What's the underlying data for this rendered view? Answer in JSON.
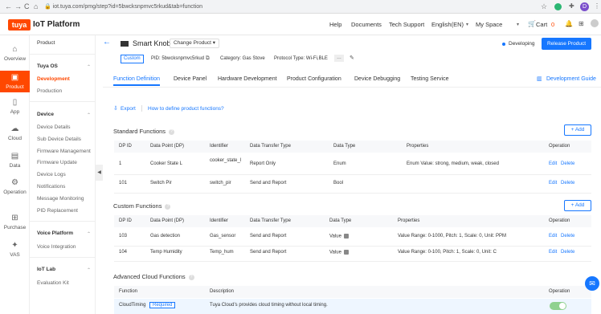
{
  "browser": {
    "url": "iot.tuya.com/pmg/step?id=5bwcksnpmvc5rkud&tab=function",
    "avatar": "D",
    "back": "←",
    "forward": "→",
    "reload": "C",
    "home": "⌂"
  },
  "header": {
    "logo_box": "tuya",
    "logo_text": "IoT Platform",
    "nav": [
      "Help",
      "Documents",
      "Tech Support",
      "English(EN)",
      "My Space",
      "Cart"
    ],
    "cart_count": "0"
  },
  "rail": [
    {
      "label": "Overview",
      "icon": "home-icon",
      "glyph": "⌂"
    },
    {
      "label": "Product",
      "icon": "product-icon",
      "glyph": "▣"
    },
    {
      "label": "App",
      "icon": "app-icon",
      "glyph": "▯"
    },
    {
      "label": "Cloud",
      "icon": "cloud-icon",
      "glyph": "☁"
    },
    {
      "label": "Data",
      "icon": "data-icon",
      "glyph": "▤"
    },
    {
      "label": "Operation",
      "icon": "operation-icon",
      "glyph": "⚙"
    },
    {
      "label": "Purchase",
      "icon": "purchase-icon",
      "glyph": "⊞"
    },
    {
      "label": "VAS",
      "icon": "vas-icon",
      "glyph": "✦"
    }
  ],
  "subnav": {
    "product": "Product",
    "tuya_os": "Tuya OS",
    "development": "Development",
    "production": "Production",
    "device": "Device",
    "device_items": [
      "Device Details",
      "Sub Device Details",
      "Firmware Management",
      "Firmware Update",
      "Device Logs",
      "Notifications",
      "Message Monitoring",
      "PID Replacement"
    ],
    "voice": "Voice Platform",
    "voice_items": [
      "Voice Integration"
    ],
    "iot_lab": "IoT Lab",
    "iot_items": [
      "Evaluation Kit"
    ]
  },
  "product": {
    "name": "Smart Knob",
    "change": "Change Product",
    "custom": "Custom",
    "pid": "PID: 5bwcksnpmvc5rkud",
    "category": "Category: Gas Stove",
    "protocol": "Protocol Type: Wi-Fi,BLE",
    "status": "Developing",
    "release": "Release Product"
  },
  "tabs": [
    "Function Definition",
    "Device Panel",
    "Hardware Development",
    "Product Configuration",
    "Device Debugging",
    "Testing Service"
  ],
  "dev_guide": "Development Guide",
  "export": "Export",
  "define": "How to define product functions?",
  "standard": {
    "title": "Standard Functions",
    "add": "+ Add",
    "headers": [
      "DP ID",
      "Data Point (DP)",
      "Identifier",
      "Data Transfer Type",
      "Data Type",
      "Properties",
      "Operation"
    ],
    "rows": [
      [
        "1",
        "Cooker State L",
        "cooker_state_l",
        "Report Only",
        "Enum",
        "Enum Value: strong, medium, weak, closed"
      ],
      [
        "101",
        "Switch Pir",
        "switch_pir",
        "Send and Report",
        "Bool",
        ""
      ]
    ]
  },
  "custom": {
    "title": "Custom Functions",
    "add": "+ Add",
    "headers": [
      "DP ID",
      "Data Point (DP)",
      "Identifier",
      "Data Transfer Type",
      "Data Type",
      "Properties",
      "Operation"
    ],
    "rows": [
      [
        "103",
        "Gas detection",
        "Gas_sensor",
        "Send and Report",
        "Value",
        "Value Range: 0-1000, Pitch: 1, Scale: 0, Unit: PPM"
      ],
      [
        "104",
        "Temp Humidity",
        "Temp_hum",
        "Send and Report",
        "Value",
        "Value Range: 0-100, Pitch: 1, Scale: 0, Unit: C"
      ]
    ]
  },
  "advanced": {
    "title": "Advanced Cloud Functions",
    "headers": [
      "Function",
      "Description",
      "Operation"
    ],
    "row": [
      "CloudTiming",
      "Required",
      "Tuya Cloud’s provides cloud timing without local timing."
    ]
  },
  "ops": {
    "edit": "Edit",
    "delete": "Delete"
  },
  "colors": {
    "accent": "#ff4800",
    "blue": "#1677ff",
    "green": "#52c41a"
  }
}
